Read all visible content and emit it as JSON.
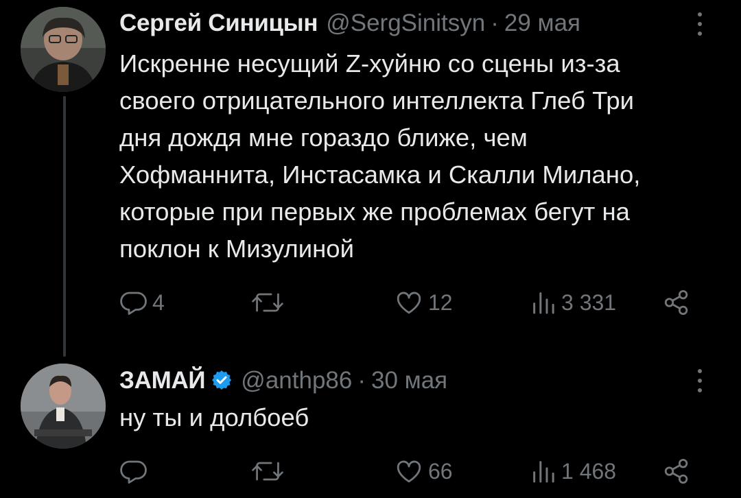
{
  "tweets": [
    {
      "author_name": "Сергей Синицын",
      "handle": "@SergSinitsyn",
      "separator": "·",
      "date": "29 мая",
      "verified": false,
      "text_lines": [
        "Искренне несущий Z-хуйню со сцены из-за",
        "своего отрицательного интеллекта Глеб Три",
        "дня дождя мне гораздо ближе, чем",
        "Хофманнита, Инстасамка и Скалли Милано,",
        "которые при первых же проблемах бегут на",
        "поклон к Мизулиной"
      ],
      "replies": "4",
      "retweets": "",
      "likes": "12",
      "views": "3 331"
    },
    {
      "author_name": "ЗАМАЙ",
      "handle": "@anthp86",
      "separator": "·",
      "date": "30 мая",
      "verified": true,
      "text_lines": [
        "ну ты и долбоеб"
      ],
      "replies": "",
      "retweets": "",
      "likes": "66",
      "views": "1 468"
    }
  ],
  "icons": {
    "reply": "reply-icon",
    "retweet": "retweet-icon",
    "like": "heart-icon",
    "views": "views-icon",
    "share": "share-icon",
    "more": "more-options-icon",
    "verified": "verified-badge-icon"
  },
  "colors": {
    "background": "#000000",
    "text_primary": "#e7e9ea",
    "text_secondary": "#71767b",
    "verified_blue": "#1d9bf0",
    "thread_line": "#333639"
  }
}
